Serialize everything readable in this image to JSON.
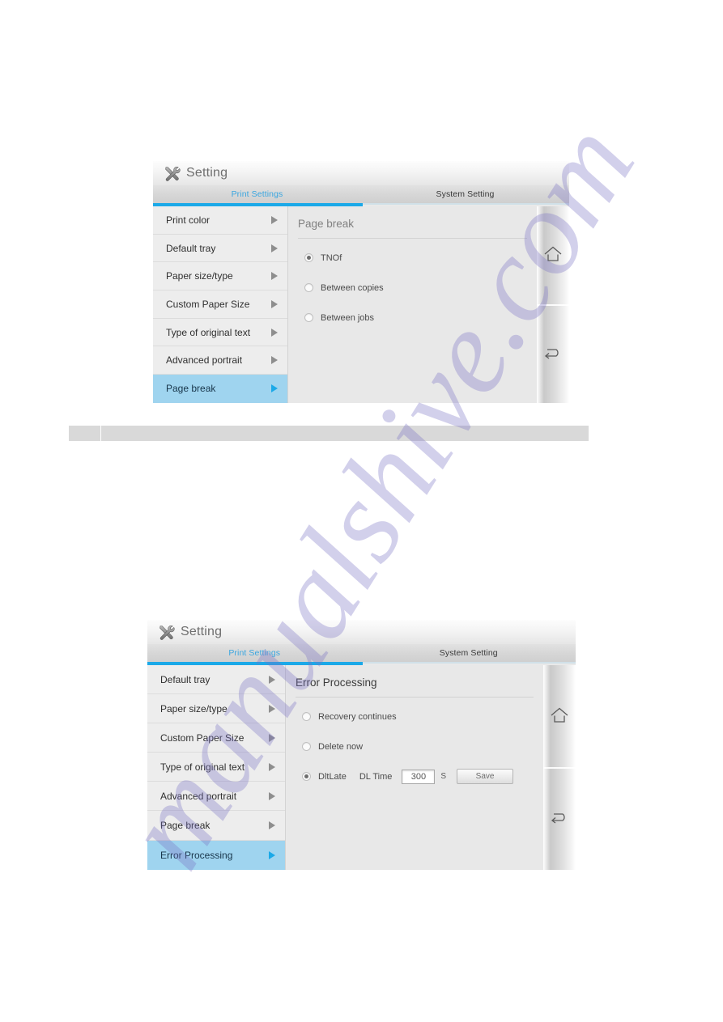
{
  "page": {
    "watermark_text": "manualshive.com"
  },
  "screens": [
    {
      "id": "page-break-screen",
      "titlebar": {
        "icon": "tools-icon",
        "title": "Setting"
      },
      "tabs": [
        {
          "label": "Print Settings",
          "active": true
        },
        {
          "label": "System Setting",
          "active": false
        }
      ],
      "menu": {
        "items": [
          {
            "label": "Print color",
            "selected": false
          },
          {
            "label": "Default tray",
            "selected": false
          },
          {
            "label": "Paper size/type",
            "selected": false
          },
          {
            "label": "Custom Paper Size",
            "selected": false
          },
          {
            "label": "Type of original text",
            "selected": false
          },
          {
            "label": "Advanced portrait",
            "selected": false
          },
          {
            "label": "Page break",
            "selected": true
          }
        ]
      },
      "content": {
        "heading": "Page break",
        "options": [
          {
            "label": "TNOf",
            "checked": true
          },
          {
            "label": "Between copies",
            "checked": false
          },
          {
            "label": "Between jobs",
            "checked": false
          }
        ]
      },
      "rail": [
        {
          "icon": "home-icon"
        },
        {
          "icon": "back-arrow-icon"
        }
      ]
    },
    {
      "id": "error-processing-screen",
      "titlebar": {
        "icon": "tools-icon",
        "title": "Setting"
      },
      "tabs": [
        {
          "label": "Print Settings",
          "active": true
        },
        {
          "label": "System Setting",
          "active": false
        }
      ],
      "menu": {
        "items": [
          {
            "label": "Default tray",
            "selected": false
          },
          {
            "label": "Paper size/type",
            "selected": false
          },
          {
            "label": "Custom Paper Size",
            "selected": false
          },
          {
            "label": "Type of original text",
            "selected": false
          },
          {
            "label": "Advanced portrait",
            "selected": false
          },
          {
            "label": "Page break",
            "selected": false
          },
          {
            "label": "Error Processing",
            "selected": true
          }
        ]
      },
      "content": {
        "heading": "Error Processing",
        "options": [
          {
            "label": "Recovery continues",
            "checked": false
          },
          {
            "label": "Delete now",
            "checked": false
          },
          {
            "label": "DltLate",
            "checked": true
          }
        ],
        "dl_time_label": "DL Time",
        "dl_time_value": "300",
        "dl_time_unit": "S",
        "save_label": "Save"
      },
      "rail": [
        {
          "icon": "home-icon"
        },
        {
          "icon": "back-arrow-icon"
        }
      ]
    }
  ],
  "colors": {
    "accent_blue": "#1ba9e8",
    "tab_active_text": "#3aa6e0",
    "selected_row": "#9fd4ef",
    "panel_bg": "#e8e8e8",
    "menu_bg": "#ededed"
  }
}
